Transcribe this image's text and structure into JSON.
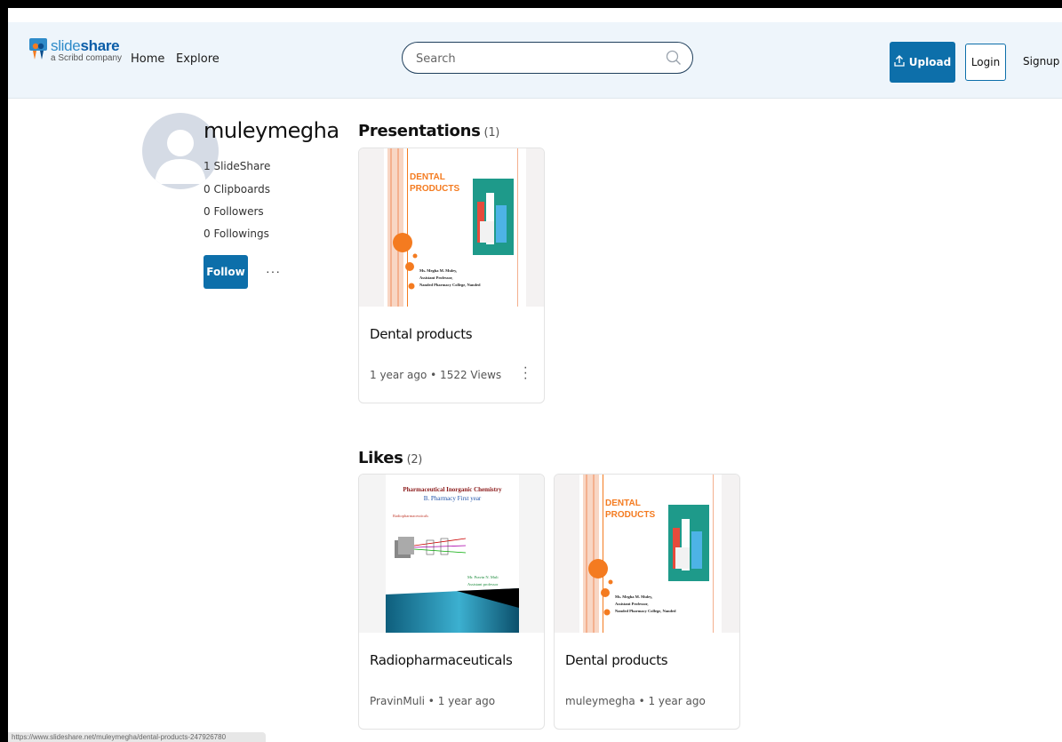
{
  "header": {
    "logo_main_a": "slide",
    "logo_main_b": "share",
    "logo_sub": "a Scribd company",
    "nav": [
      "Home",
      "Explore"
    ],
    "search_placeholder": "Search",
    "upload_label": "Upload",
    "login_label": "Login",
    "signup_label": "Signup"
  },
  "profile": {
    "username": "muleymegha",
    "stats": [
      "1 SlideShare",
      "0 Clipboards",
      "0 Followers",
      "0 Followings"
    ],
    "follow_label": "Follow",
    "more_label": "···"
  },
  "presentations": {
    "title": "Presentations",
    "count": "(1)",
    "items": [
      {
        "title": "Dental products",
        "meta": "1 year ago • 1522 Views",
        "thumb_title_line1": "DENTAL",
        "thumb_title_line2": "PRODUCTS",
        "thumb_author_1": "Ms. Megha M. Muley,",
        "thumb_author_2": "Assistant Professor,",
        "thumb_author_3": "Nanded Pharmacy College, Nanded"
      }
    ]
  },
  "likes": {
    "title": "Likes",
    "count": "(2)",
    "items": [
      {
        "title": "Radiopharmaceuticals",
        "meta": "PravinMuli • 1 year ago",
        "thumb_line1": "Pharmaceutical Inorganic Chemistry",
        "thumb_line2": "B. Pharmacy First year",
        "thumb_line3": "Radiopharmaceuticals",
        "thumb_author_1": "Mr. Pravin N. Muli",
        "thumb_author_2": "Assistant professor"
      },
      {
        "title": "Dental products",
        "meta": "muleymegha • 1 year ago",
        "thumb_title_line1": "DENTAL",
        "thumb_title_line2": "PRODUCTS",
        "thumb_author_1": "Ms. Megha M. Muley,",
        "thumb_author_2": "Assistant Professor,",
        "thumb_author_3": "Nanded Pharmacy College, Nanded"
      }
    ]
  },
  "statusbar": {
    "url": "https://www.slideshare.net/muleymegha/dental-products-247926780"
  },
  "colors": {
    "brand": "#0d6faa",
    "header_bg": "#eef5fb",
    "accent_orange": "#f47b20"
  }
}
